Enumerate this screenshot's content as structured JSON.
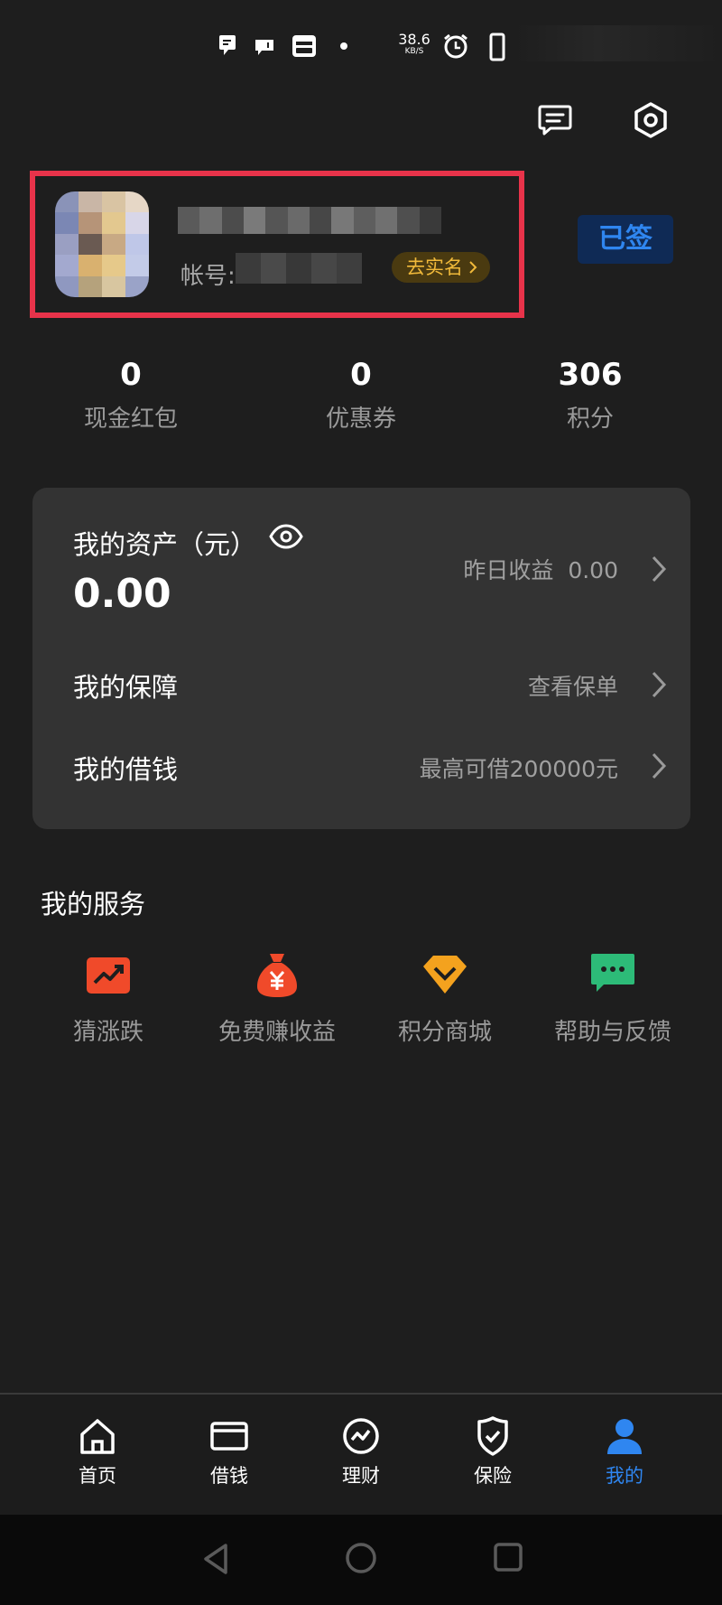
{
  "status_bar": {
    "speed_value": "38.6",
    "speed_unit": "KB/S",
    "icons": [
      "chat-bubble-icon",
      "notification-icon",
      "card-icon",
      "dot-icon",
      "alarm-icon",
      "battery-icon"
    ]
  },
  "header": {
    "icons": [
      "message-icon",
      "settings-icon"
    ]
  },
  "profile": {
    "account_label": "帐号:",
    "verify_button": "去实名",
    "signed_badge": "已签"
  },
  "stats": [
    {
      "value": "0",
      "label": "现金红包"
    },
    {
      "value": "0",
      "label": "优惠券"
    },
    {
      "value": "306",
      "label": "积分"
    }
  ],
  "assets_card": {
    "title": "我的资产（元）",
    "amount": "0.00",
    "yesterday_label": "昨日收益",
    "yesterday_value": "0.00",
    "rows": [
      {
        "label": "我的保障",
        "right": "查看保单"
      },
      {
        "label": "我的借钱",
        "right": "最高可借200000元"
      }
    ]
  },
  "services": {
    "title": "我的服务",
    "items": [
      {
        "label": "猜涨跌",
        "icon": "trend-up-icon",
        "color": "#f04a2a"
      },
      {
        "label": "免费赚收益",
        "icon": "money-bag-icon",
        "color": "#f04a2a"
      },
      {
        "label": "积分商城",
        "icon": "diamond-icon",
        "color": "#f4a21e"
      },
      {
        "label": "帮助与反馈",
        "icon": "chat-dots-icon",
        "color": "#2dbb78"
      }
    ]
  },
  "tabbar": {
    "items": [
      {
        "label": "首页",
        "icon": "home-icon"
      },
      {
        "label": "借钱",
        "icon": "card-icon"
      },
      {
        "label": "理财",
        "icon": "chart-circle-icon"
      },
      {
        "label": "保险",
        "icon": "shield-check-icon"
      },
      {
        "label": "我的",
        "icon": "user-icon",
        "active": true
      }
    ],
    "active_color": "#2f86f0"
  },
  "system_nav": [
    "back-icon",
    "home-circle-icon",
    "recents-icon"
  ]
}
